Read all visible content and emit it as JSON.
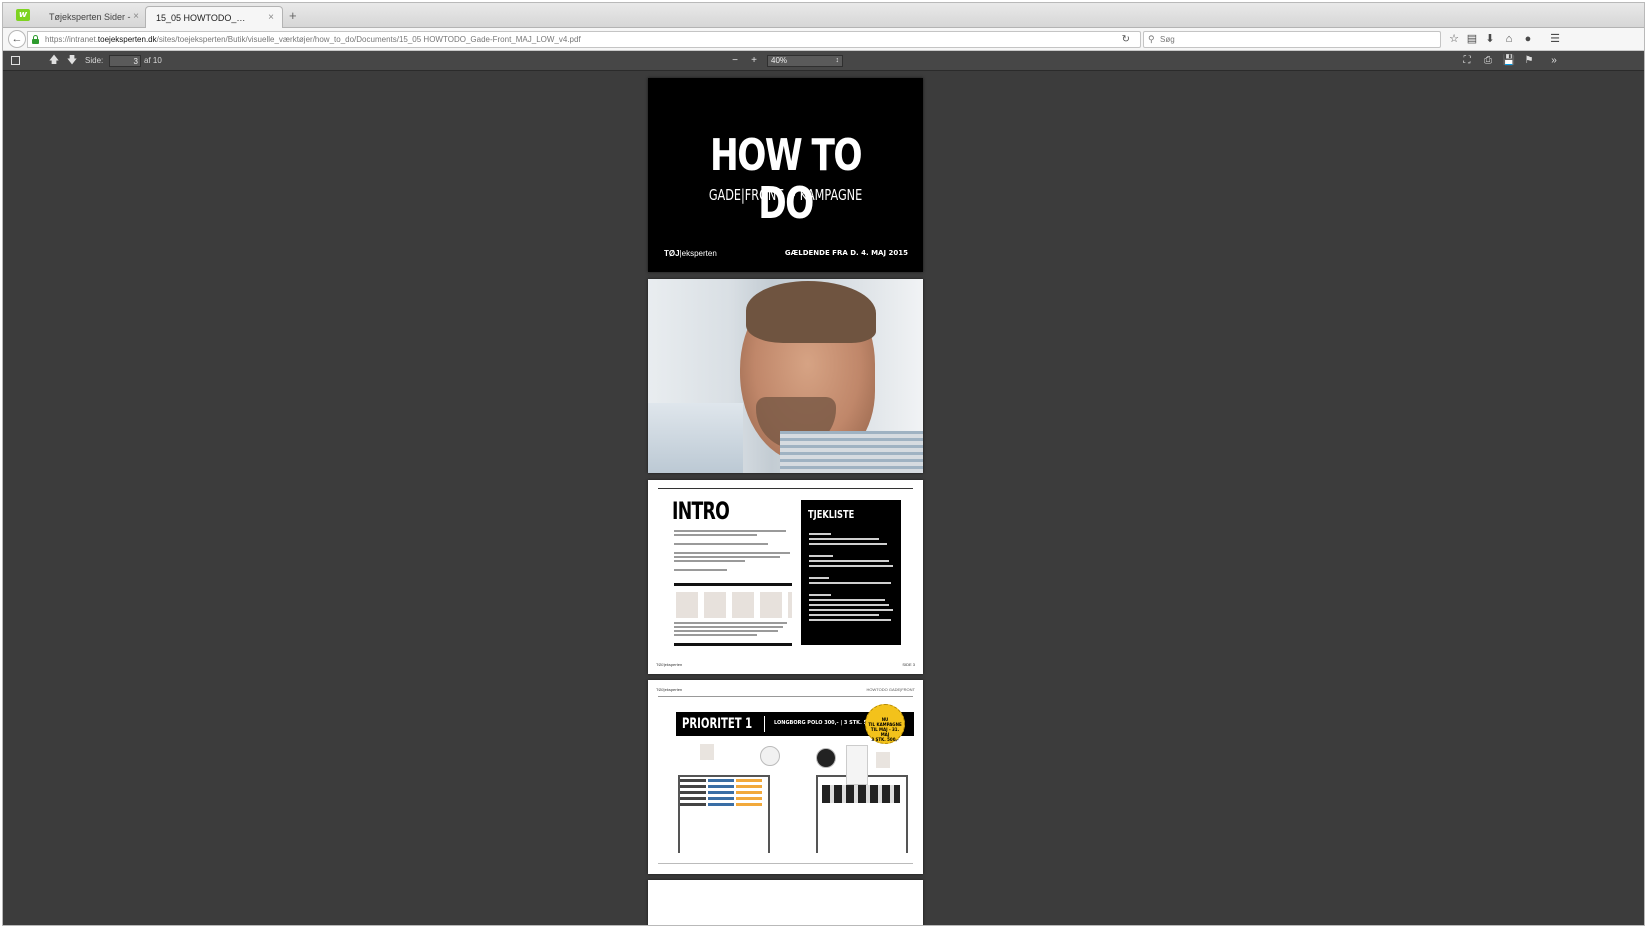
{
  "tabs": [
    {
      "title": "Tøjeksperten Sider -",
      "close": "×"
    },
    {
      "title": "15_05 HOWTODO_Gade-Front_...",
      "close": "×"
    }
  ],
  "new_tab": "+",
  "url": {
    "prefix": "https://intranet.",
    "host": "toejeksperten.dk",
    "path": "/sites/toejeksperten/Butik/visuelle_værktøjer/how_to_do/Documents/15_05 HOWTODO_Gade-Front_MAJ_LOW_v4.pdf"
  },
  "search": {
    "placeholder": "Søg"
  },
  "pdf_toolbar": {
    "page_label": "Side:",
    "page_value": "3",
    "page_total": "af 10",
    "zoom": "40%"
  },
  "page1": {
    "title": "HOW TO DO",
    "subtitle": "GADE|FRONT + KAMPAGNE",
    "logo_a": "TØJ",
    "logo_b": "|eksperten",
    "valid_from": "GÆLDENDE FRA D. 4. MAJ 2015"
  },
  "page3": {
    "heading": "INTRO",
    "checklist_title": "TJEKLISTE",
    "footer_a": "TØJ",
    "footer_b": "|eksperten",
    "page_number": "SIDE 3"
  },
  "page4": {
    "header_logo": "TØJ|eksperten",
    "header_right": "HOWTODO GADE|FRONT",
    "title": "PRIORITET 1",
    "info": "LONGBORG POLO 300,- | 3 STK. 500,-",
    "badge_lines": [
      "NU",
      "TIL KAMPAGNE",
      "TIL MAJ - 31. MAJ",
      "3 STK. 500,-"
    ]
  },
  "icons": {
    "app_logo": "w-logo-icon",
    "back": "arrow-left-icon",
    "reload": "reload-icon",
    "search": "search-icon",
    "bookmark_star": "star-icon",
    "reader": "reader-icon",
    "download": "download-icon",
    "home": "home-icon",
    "chat": "chat-icon",
    "menu": "hamburger-menu-icon"
  }
}
